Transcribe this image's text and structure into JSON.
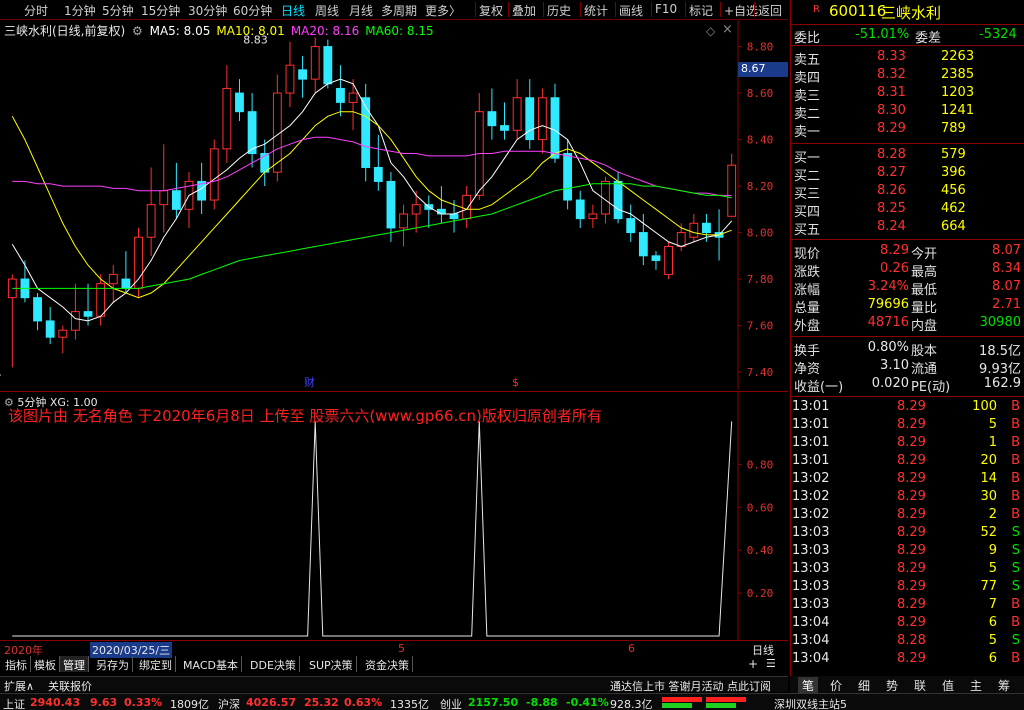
{
  "topbar": {
    "items": [
      "分时",
      "1分钟",
      "5分钟",
      "15分钟",
      "30分钟",
      "60分钟",
      "日线",
      "周线",
      "月线",
      "多周期",
      "更多〉"
    ],
    "active": "日线",
    "right_items": [
      "复权",
      "叠加",
      "历史",
      "统计",
      "画线",
      "F10",
      "标记",
      "+自选",
      "返回"
    ]
  },
  "main_chart": {
    "title": "三峡水利(日线,前复权)",
    "ma_labels": [
      {
        "text": "MA5: 8.05",
        "color": "#ffffff"
      },
      {
        "text": "MA10: 8.01",
        "color": "#ffff00"
      },
      {
        "text": "MA20: 8.16",
        "color": "#ff40ff"
      },
      {
        "text": "MA60: 8.15",
        "color": "#00ff00"
      }
    ],
    "yaxis": [
      "8.80",
      "8.60",
      "8.40",
      "8.20",
      "8.00",
      "7.80",
      "7.60",
      "7.40"
    ],
    "current_price_tag": "8.67",
    "max_label": "8.83",
    "min_label": "7.41",
    "markers": [
      "财",
      "$"
    ]
  },
  "indicator_chart": {
    "title": "5分钟 XG: 1.00",
    "yaxis": [
      "0.80",
      "0.60",
      "0.40",
      "0.20"
    ],
    "watermark": "该图片由 无名角色 于2020年6月8日 上传至 股票六六(www.gp66.cn)版权归原创者所有"
  },
  "xaxis": {
    "year": "2020年",
    "cursor_date": "2020/03/25/三",
    "month1": "5",
    "month2": "6",
    "period": "日线"
  },
  "bottom_tabs": [
    "指标",
    "模板",
    "管理",
    "另存为",
    "绑定到",
    "MACD基本",
    "DDE决策",
    "SUP决策",
    "资金决策"
  ],
  "bottom_tabs_active": "管理",
  "status1": {
    "left": [
      "扩展∧",
      "关联报价"
    ],
    "right": "通达信上市 答谢月活动 点此订阅"
  },
  "status2": {
    "sh": {
      "name": "上证",
      "price": "2940.43",
      "chg": "9.63",
      "pct": "0.33%",
      "vol": "1809亿"
    },
    "hs": {
      "name": "沪深",
      "price": "4026.57",
      "chg": "25.32",
      "pct": "0.63%",
      "vol": "1335亿"
    },
    "cy": {
      "name": "创业",
      "price": "2157.50",
      "chg": "-8.88",
      "pct": "-0.41%",
      "vol": "928.3亿"
    },
    "server": "深圳双线主站5"
  },
  "rpanel": {
    "badge": "R",
    "code": "600116",
    "name": "三峡水利",
    "weibi_label": "委比",
    "weibi": "-51.01%",
    "weicha_label": "委差",
    "weicha": "-5324",
    "asks": [
      {
        "label": "卖五",
        "price": "8.33",
        "vol": "2263"
      },
      {
        "label": "卖四",
        "price": "8.32",
        "vol": "2385"
      },
      {
        "label": "卖三",
        "price": "8.31",
        "vol": "1203"
      },
      {
        "label": "卖二",
        "price": "8.30",
        "vol": "1241"
      },
      {
        "label": "卖一",
        "price": "8.29",
        "vol": "789"
      }
    ],
    "bids": [
      {
        "label": "买一",
        "price": "8.28",
        "vol": "579"
      },
      {
        "label": "买二",
        "price": "8.27",
        "vol": "396"
      },
      {
        "label": "买三",
        "price": "8.26",
        "vol": "456"
      },
      {
        "label": "买四",
        "price": "8.25",
        "vol": "462"
      },
      {
        "label": "买五",
        "price": "8.24",
        "vol": "664"
      }
    ],
    "stats": [
      {
        "l1": "现价",
        "v1": "8.29",
        "c1": "red",
        "l2": "今开",
        "v2": "8.07",
        "c2": "red"
      },
      {
        "l1": "涨跌",
        "v1": "0.26",
        "c1": "red",
        "l2": "最高",
        "v2": "8.34",
        "c2": "red"
      },
      {
        "l1": "涨幅",
        "v1": "3.24%",
        "c1": "red",
        "l2": "最低",
        "v2": "8.07",
        "c2": "red"
      },
      {
        "l1": "总量",
        "v1": "79696",
        "c1": "yellow",
        "l2": "量比",
        "v2": "2.71",
        "c2": "red"
      },
      {
        "l1": "外盘",
        "v1": "48716",
        "c1": "red",
        "l2": "内盘",
        "v2": "30980",
        "c2": "green"
      }
    ],
    "stats2": [
      {
        "l1": "换手",
        "v1": "0.80%",
        "l2": "股本",
        "v2": "18.5亿"
      },
      {
        "l1": "净资",
        "v1": "3.10",
        "l2": "流通",
        "v2": "9.93亿"
      },
      {
        "l1": "收益(一)",
        "v1": "0.020",
        "l2": "PE(动)",
        "v2": "162.9"
      }
    ],
    "ticks": [
      {
        "time": "13:01",
        "price": "8.29",
        "vol": "100",
        "side": "B"
      },
      {
        "time": "13:01",
        "price": "8.29",
        "vol": "5",
        "side": "B"
      },
      {
        "time": "13:01",
        "price": "8.29",
        "vol": "1",
        "side": "B"
      },
      {
        "time": "13:01",
        "price": "8.29",
        "vol": "20",
        "side": "B"
      },
      {
        "time": "13:02",
        "price": "8.29",
        "vol": "14",
        "side": "B"
      },
      {
        "time": "13:02",
        "price": "8.29",
        "vol": "30",
        "side": "B"
      },
      {
        "time": "13:02",
        "price": "8.29",
        "vol": "2",
        "side": "B"
      },
      {
        "time": "13:03",
        "price": "8.29",
        "vol": "52",
        "side": "S"
      },
      {
        "time": "13:03",
        "price": "8.29",
        "vol": "9",
        "side": "S"
      },
      {
        "time": "13:03",
        "price": "8.29",
        "vol": "5",
        "side": "S"
      },
      {
        "time": "13:03",
        "price": "8.29",
        "vol": "77",
        "side": "S"
      },
      {
        "time": "13:03",
        "price": "8.29",
        "vol": "7",
        "side": "B"
      },
      {
        "time": "13:04",
        "price": "8.29",
        "vol": "6",
        "side": "B"
      },
      {
        "time": "13:04",
        "price": "8.28",
        "vol": "5",
        "side": "S"
      },
      {
        "time": "13:04",
        "price": "8.29",
        "vol": "6",
        "side": "B"
      }
    ],
    "tabs": [
      "笔",
      "价",
      "细",
      "势",
      "联",
      "值",
      "主",
      "筹"
    ],
    "tabs_active": "笔"
  },
  "chart_data": {
    "type": "candlestick",
    "ylim": [
      7.34,
      8.88
    ],
    "candles": [
      {
        "o": 7.72,
        "h": 7.82,
        "l": 7.42,
        "c": 7.8
      },
      {
        "o": 7.8,
        "h": 7.88,
        "l": 7.7,
        "c": 7.72
      },
      {
        "o": 7.72,
        "h": 7.74,
        "l": 7.58,
        "c": 7.62
      },
      {
        "o": 7.62,
        "h": 7.68,
        "l": 7.52,
        "c": 7.55
      },
      {
        "o": 7.55,
        "h": 7.6,
        "l": 7.48,
        "c": 7.58
      },
      {
        "o": 7.58,
        "h": 7.78,
        "l": 7.54,
        "c": 7.66
      },
      {
        "o": 7.66,
        "h": 7.78,
        "l": 7.6,
        "c": 7.64
      },
      {
        "o": 7.64,
        "h": 7.82,
        "l": 7.6,
        "c": 7.78
      },
      {
        "o": 7.78,
        "h": 7.86,
        "l": 7.7,
        "c": 7.82
      },
      {
        "o": 7.8,
        "h": 7.92,
        "l": 7.74,
        "c": 7.76
      },
      {
        "o": 7.76,
        "h": 8.02,
        "l": 7.72,
        "c": 7.98
      },
      {
        "o": 7.98,
        "h": 8.28,
        "l": 7.9,
        "c": 8.12
      },
      {
        "o": 8.12,
        "h": 8.38,
        "l": 8.0,
        "c": 8.18
      },
      {
        "o": 8.18,
        "h": 8.3,
        "l": 8.06,
        "c": 8.1
      },
      {
        "o": 8.1,
        "h": 8.26,
        "l": 8.02,
        "c": 8.22
      },
      {
        "o": 8.22,
        "h": 8.3,
        "l": 8.08,
        "c": 8.14
      },
      {
        "o": 8.14,
        "h": 8.4,
        "l": 8.1,
        "c": 8.36
      },
      {
        "o": 8.36,
        "h": 8.72,
        "l": 8.3,
        "c": 8.62
      },
      {
        "o": 8.6,
        "h": 8.66,
        "l": 8.48,
        "c": 8.52
      },
      {
        "o": 8.52,
        "h": 8.6,
        "l": 8.28,
        "c": 8.34
      },
      {
        "o": 8.34,
        "h": 8.4,
        "l": 8.2,
        "c": 8.26
      },
      {
        "o": 8.26,
        "h": 8.68,
        "l": 8.22,
        "c": 8.6
      },
      {
        "o": 8.6,
        "h": 8.82,
        "l": 8.54,
        "c": 8.72
      },
      {
        "o": 8.7,
        "h": 8.76,
        "l": 8.58,
        "c": 8.66
      },
      {
        "o": 8.66,
        "h": 8.84,
        "l": 8.6,
        "c": 8.8
      },
      {
        "o": 8.8,
        "h": 8.83,
        "l": 8.62,
        "c": 8.64
      },
      {
        "o": 8.62,
        "h": 8.72,
        "l": 8.5,
        "c": 8.56
      },
      {
        "o": 8.56,
        "h": 8.66,
        "l": 8.44,
        "c": 8.6
      },
      {
        "o": 8.58,
        "h": 8.64,
        "l": 8.22,
        "c": 8.28
      },
      {
        "o": 8.28,
        "h": 8.42,
        "l": 8.18,
        "c": 8.22
      },
      {
        "o": 8.22,
        "h": 8.26,
        "l": 7.96,
        "c": 8.02
      },
      {
        "o": 8.02,
        "h": 8.12,
        "l": 7.94,
        "c": 8.08
      },
      {
        "o": 8.08,
        "h": 8.18,
        "l": 8.0,
        "c": 8.12
      },
      {
        "o": 8.12,
        "h": 8.16,
        "l": 8.02,
        "c": 8.1
      },
      {
        "o": 8.1,
        "h": 8.2,
        "l": 8.04,
        "c": 8.08
      },
      {
        "o": 8.08,
        "h": 8.14,
        "l": 8.0,
        "c": 8.06
      },
      {
        "o": 8.06,
        "h": 8.2,
        "l": 8.02,
        "c": 8.16
      },
      {
        "o": 8.16,
        "h": 8.6,
        "l": 8.14,
        "c": 8.52
      },
      {
        "o": 8.52,
        "h": 8.62,
        "l": 8.4,
        "c": 8.46
      },
      {
        "o": 8.46,
        "h": 8.56,
        "l": 8.4,
        "c": 8.44
      },
      {
        "o": 8.44,
        "h": 8.66,
        "l": 8.4,
        "c": 8.58
      },
      {
        "o": 8.58,
        "h": 8.66,
        "l": 8.36,
        "c": 8.4
      },
      {
        "o": 8.4,
        "h": 8.62,
        "l": 8.34,
        "c": 8.58
      },
      {
        "o": 8.58,
        "h": 8.64,
        "l": 8.3,
        "c": 8.32
      },
      {
        "o": 8.34,
        "h": 8.4,
        "l": 8.1,
        "c": 8.14
      },
      {
        "o": 8.14,
        "h": 8.18,
        "l": 8.02,
        "c": 8.06
      },
      {
        "o": 8.06,
        "h": 8.12,
        "l": 8.02,
        "c": 8.08
      },
      {
        "o": 8.08,
        "h": 8.24,
        "l": 8.04,
        "c": 8.22
      },
      {
        "o": 8.22,
        "h": 8.26,
        "l": 8.04,
        "c": 8.06
      },
      {
        "o": 8.06,
        "h": 8.12,
        "l": 7.96,
        "c": 8.0
      },
      {
        "o": 8.0,
        "h": 8.08,
        "l": 7.86,
        "c": 7.9
      },
      {
        "o": 7.9,
        "h": 7.92,
        "l": 7.84,
        "c": 7.88
      },
      {
        "o": 7.82,
        "h": 7.96,
        "l": 7.8,
        "c": 7.94
      },
      {
        "o": 7.94,
        "h": 8.04,
        "l": 7.92,
        "c": 8.0
      },
      {
        "o": 7.98,
        "h": 8.08,
        "l": 7.96,
        "c": 8.04
      },
      {
        "o": 8.04,
        "h": 8.08,
        "l": 7.96,
        "c": 8.0
      },
      {
        "o": 8.0,
        "h": 8.1,
        "l": 7.88,
        "c": 7.98
      },
      {
        "o": 8.07,
        "h": 8.34,
        "l": 8.07,
        "c": 8.29
      }
    ],
    "ma_series": [
      {
        "name": "MA5",
        "color": "#ffffff",
        "values": [
          7.95,
          7.86,
          7.76,
          7.72,
          7.68,
          7.63,
          7.62,
          7.64,
          7.7,
          7.74,
          7.8,
          7.88,
          7.98,
          8.06,
          8.16,
          8.19,
          8.23,
          8.27,
          8.32,
          8.36,
          8.38,
          8.42,
          8.46,
          8.52,
          8.6,
          8.64,
          8.66,
          8.64,
          8.54,
          8.46,
          8.3,
          8.24,
          8.16,
          8.11,
          8.08,
          8.08,
          8.1,
          8.18,
          8.24,
          8.32,
          8.4,
          8.44,
          8.46,
          8.44,
          8.4,
          8.3,
          8.18,
          8.14,
          8.1,
          8.08,
          8.04,
          8.0,
          7.96,
          7.94,
          7.96,
          7.98,
          7.99,
          8.05
        ]
      },
      {
        "name": "MA10",
        "color": "#ffff00",
        "values": [
          8.5,
          8.4,
          8.28,
          8.16,
          8.04,
          7.94,
          7.86,
          7.8,
          7.76,
          7.74,
          7.72,
          7.74,
          7.78,
          7.84,
          7.9,
          7.96,
          8.02,
          8.08,
          8.14,
          8.2,
          8.26,
          8.3,
          8.34,
          8.4,
          8.46,
          8.5,
          8.52,
          8.52,
          8.5,
          8.46,
          8.4,
          8.32,
          8.24,
          8.18,
          8.14,
          8.12,
          8.1,
          8.1,
          8.12,
          8.16,
          8.2,
          8.24,
          8.3,
          8.34,
          8.36,
          8.34,
          8.3,
          8.26,
          8.22,
          8.18,
          8.14,
          8.1,
          8.06,
          8.02,
          8.0,
          7.99,
          7.99,
          8.01
        ]
      },
      {
        "name": "MA20",
        "color": "#ff40ff",
        "values": [
          8.22,
          8.22,
          8.21,
          8.21,
          8.2,
          8.2,
          8.2,
          8.2,
          8.19,
          8.19,
          8.18,
          8.18,
          8.18,
          8.19,
          8.2,
          8.21,
          8.22,
          8.24,
          8.27,
          8.3,
          8.33,
          8.36,
          8.38,
          8.4,
          8.41,
          8.41,
          8.4,
          8.39,
          8.37,
          8.36,
          8.35,
          8.34,
          8.34,
          8.33,
          8.33,
          8.33,
          8.33,
          8.34,
          8.34,
          8.35,
          8.35,
          8.35,
          8.35,
          8.34,
          8.33,
          8.32,
          8.31,
          8.29,
          8.26,
          8.24,
          8.22,
          8.2,
          8.19,
          8.18,
          8.17,
          8.17,
          8.16,
          8.16
        ]
      },
      {
        "name": "MA60",
        "color": "#00ff00",
        "values": [
          7.76,
          7.76,
          7.76,
          7.76,
          7.76,
          7.76,
          7.76,
          7.76,
          7.76,
          7.76,
          7.76,
          7.77,
          7.78,
          7.79,
          7.8,
          7.82,
          7.84,
          7.86,
          7.88,
          7.89,
          7.9,
          7.91,
          7.92,
          7.93,
          7.94,
          7.95,
          7.96,
          7.97,
          7.98,
          7.99,
          8.0,
          8.01,
          8.02,
          8.03,
          8.04,
          8.05,
          8.06,
          8.07,
          8.08,
          8.1,
          8.12,
          8.14,
          8.16,
          8.18,
          8.19,
          8.2,
          8.21,
          8.21,
          8.21,
          8.21,
          8.2,
          8.2,
          8.19,
          8.18,
          8.17,
          8.16,
          8.16,
          8.15
        ]
      }
    ],
    "xg_series": {
      "name": "XG",
      "ylim": [
        0,
        1.1
      ],
      "spike_indices": [
        24,
        37,
        57
      ],
      "values": [
        0,
        0,
        0,
        0,
        0,
        0,
        0,
        0,
        0,
        0,
        0,
        0,
        0,
        0,
        0,
        0,
        0,
        0,
        0,
        0,
        0,
        0,
        0,
        0,
        0,
        0,
        0,
        0,
        0,
        0,
        0,
        0,
        0,
        0,
        0,
        0,
        0,
        0,
        0,
        0,
        0,
        0,
        0,
        0,
        0,
        0,
        0,
        0,
        0,
        0,
        0,
        0,
        0,
        0,
        0,
        0,
        0,
        1
      ]
    }
  }
}
